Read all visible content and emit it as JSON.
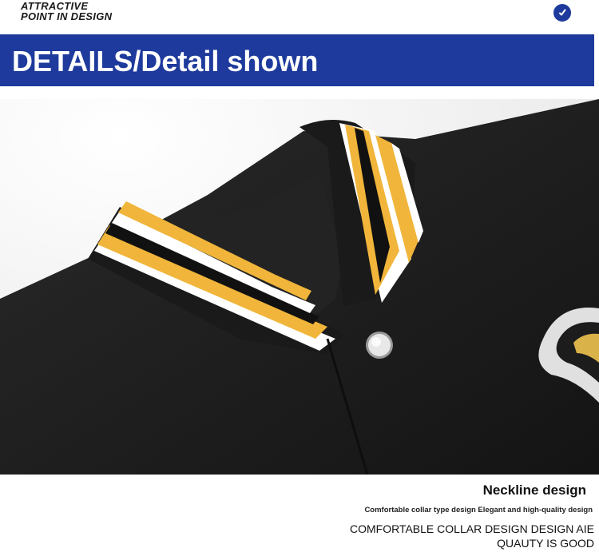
{
  "header": {
    "tagline_line1": "ATTRACTIVE",
    "tagline_line2": "POINT IN DESIGN",
    "badge_icon": "checkmark-icon",
    "accent_color": "#1e3a9c"
  },
  "banner": {
    "title": "DETAILS/Detail shown"
  },
  "product_image": {
    "subject": "varsity-jacket-collar",
    "stripe_colors": [
      "#f0b53a",
      "#ffffff",
      "#111111"
    ],
    "body_color": "#1c1c1c"
  },
  "caption": {
    "title": "Neckline design",
    "subtitle": "Comfortable collar type design Elegant and high-quality design",
    "body": "COMFORTABLE COLLAR DESIGN DESIGN AIE QUAUTY IS GOOD"
  }
}
